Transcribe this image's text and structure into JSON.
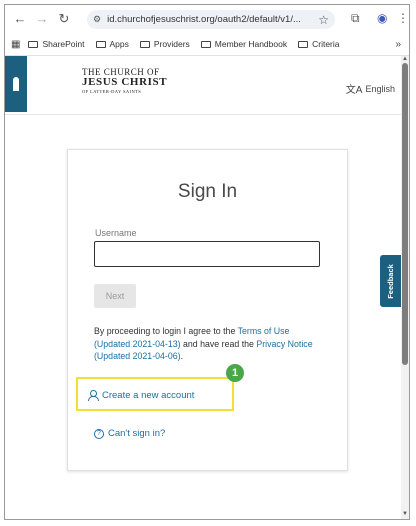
{
  "browser": {
    "url": "id.churchofjesuschrist.org/oauth2/default/v1/...",
    "bookmarks": [
      "SharePoint",
      "Apps",
      "Providers",
      "Member Handbook",
      "Criteria"
    ]
  },
  "header": {
    "logo_line1": "THE CHURCH OF",
    "logo_line2": "JESUS CHRIST",
    "logo_line3": "OF LATTER-DAY SAINTS",
    "language": "English"
  },
  "signin": {
    "title": "Sign In",
    "username_label": "Username",
    "username_value": "",
    "next_label": "Next",
    "terms_prefix": "By proceeding to login I agree to the ",
    "terms_link": "Terms of Use (Updated 2021-04-13)",
    "terms_middle": " and have read the ",
    "privacy_link": "Privacy Notice (Updated 2021-04-06)",
    "terms_suffix": ".",
    "create_account": "Create a new account",
    "cant_sign_in": "Can't sign in?",
    "step_badge": "1"
  },
  "feedback_label": "Feedback",
  "colors": {
    "brand": "#1c5f7e",
    "link": "#1a6fa3",
    "highlight": "#f4dd34",
    "badge": "#4aa64a"
  }
}
